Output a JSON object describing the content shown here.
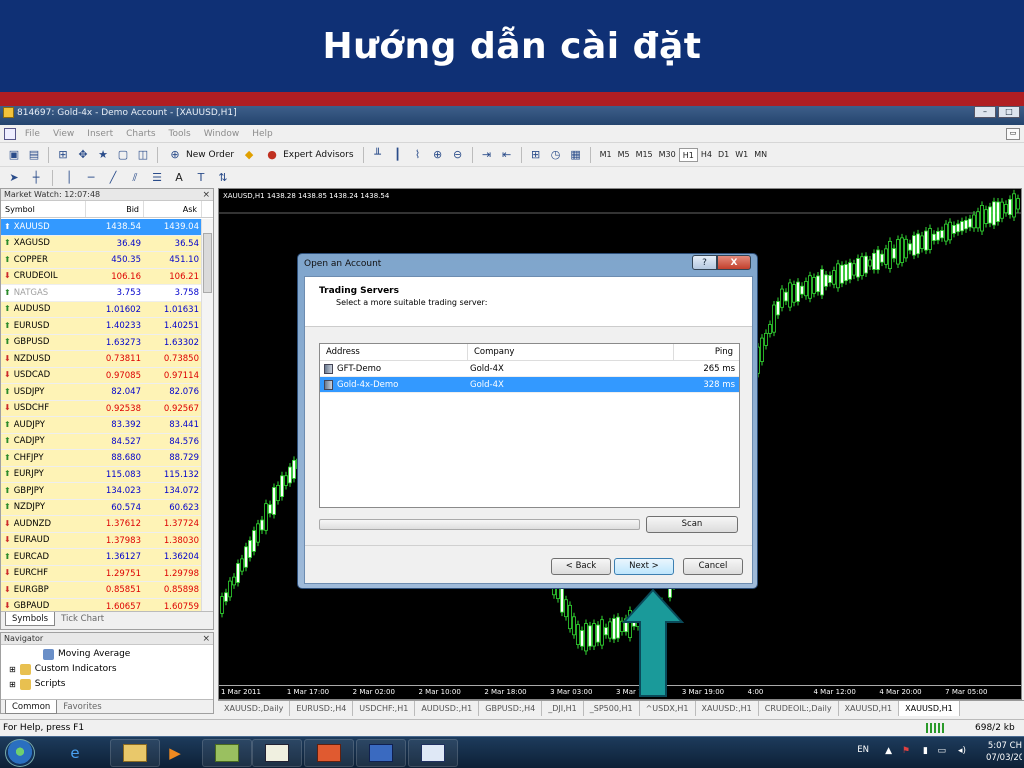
{
  "slide": {
    "title": "Hướng dẫn cài đặt"
  },
  "window": {
    "title": "814697: Gold-4x - Demo Account - [XAUUSD,H1]",
    "menu": [
      "File",
      "View",
      "Insert",
      "Charts",
      "Tools",
      "Window",
      "Help"
    ]
  },
  "toolbar": {
    "new_order": "New Order",
    "expert_advisors": "Expert Advisors",
    "timeframes": [
      "M1",
      "M5",
      "M15",
      "M30",
      "H1",
      "H4",
      "D1",
      "W1",
      "MN"
    ],
    "active_timeframe": "H1",
    "text_tool": "A"
  },
  "market_watch": {
    "title": "Market Watch: 12:07:48",
    "headers": {
      "symbol": "Symbol",
      "bid": "Bid",
      "ask": "Ask"
    },
    "rows": [
      {
        "symbol": "XAUUSD",
        "bid": "1438.54",
        "ask": "1439.04",
        "dir": "up",
        "style": "sel",
        "color": "#ffffff"
      },
      {
        "symbol": "XAGUSD",
        "bid": "36.49",
        "ask": "36.54",
        "dir": "up",
        "style": "yellow",
        "color": "#0000cc"
      },
      {
        "symbol": "COPPER",
        "bid": "450.35",
        "ask": "451.10",
        "dir": "up",
        "style": "yellow",
        "color": "#0000cc"
      },
      {
        "symbol": "CRUDEOIL",
        "bid": "106.16",
        "ask": "106.21",
        "dir": "down",
        "style": "yellow",
        "color": "#dd0000"
      },
      {
        "symbol": "NATGAS",
        "bid": "3.753",
        "ask": "3.758",
        "dir": "up",
        "style": "dim",
        "color": "#0000cc"
      },
      {
        "symbol": "AUDUSD",
        "bid": "1.01602",
        "ask": "1.01631",
        "dir": "up",
        "style": "yellow",
        "color": "#0000cc"
      },
      {
        "symbol": "EURUSD",
        "bid": "1.40233",
        "ask": "1.40251",
        "dir": "up",
        "style": "yellow",
        "color": "#0000cc"
      },
      {
        "symbol": "GBPUSD",
        "bid": "1.63273",
        "ask": "1.63302",
        "dir": "up",
        "style": "yellow",
        "color": "#0000cc"
      },
      {
        "symbol": "NZDUSD",
        "bid": "0.73811",
        "ask": "0.73850",
        "dir": "down",
        "style": "yellow",
        "color": "#dd0000"
      },
      {
        "symbol": "USDCAD",
        "bid": "0.97085",
        "ask": "0.97114",
        "dir": "down",
        "style": "yellow",
        "color": "#dd0000"
      },
      {
        "symbol": "USDJPY",
        "bid": "82.047",
        "ask": "82.076",
        "dir": "up",
        "style": "yellow",
        "color": "#0000cc"
      },
      {
        "symbol": "USDCHF",
        "bid": "0.92538",
        "ask": "0.92567",
        "dir": "down",
        "style": "yellow",
        "color": "#dd0000"
      },
      {
        "symbol": "AUDJPY",
        "bid": "83.392",
        "ask": "83.441",
        "dir": "up",
        "style": "yellow",
        "color": "#0000cc"
      },
      {
        "symbol": "CADJPY",
        "bid": "84.527",
        "ask": "84.576",
        "dir": "up",
        "style": "yellow",
        "color": "#0000cc"
      },
      {
        "symbol": "CHFJPY",
        "bid": "88.680",
        "ask": "88.729",
        "dir": "up",
        "style": "yellow",
        "color": "#0000cc"
      },
      {
        "symbol": "EURJPY",
        "bid": "115.083",
        "ask": "115.132",
        "dir": "up",
        "style": "yellow",
        "color": "#0000cc"
      },
      {
        "symbol": "GBPJPY",
        "bid": "134.023",
        "ask": "134.072",
        "dir": "up",
        "style": "yellow",
        "color": "#0000cc"
      },
      {
        "symbol": "NZDJPY",
        "bid": "60.574",
        "ask": "60.623",
        "dir": "up",
        "style": "yellow",
        "color": "#0000cc"
      },
      {
        "symbol": "AUDNZD",
        "bid": "1.37612",
        "ask": "1.37724",
        "dir": "down",
        "style": "yellow",
        "color": "#dd0000"
      },
      {
        "symbol": "EURAUD",
        "bid": "1.37983",
        "ask": "1.38030",
        "dir": "down",
        "style": "yellow",
        "color": "#dd0000"
      },
      {
        "symbol": "EURCAD",
        "bid": "1.36127",
        "ask": "1.36204",
        "dir": "up",
        "style": "yellow",
        "color": "#0000cc"
      },
      {
        "symbol": "EURCHF",
        "bid": "1.29751",
        "ask": "1.29798",
        "dir": "down",
        "style": "yellow",
        "color": "#dd0000"
      },
      {
        "symbol": "EURGBP",
        "bid": "0.85851",
        "ask": "0.85898",
        "dir": "down",
        "style": "yellow",
        "color": "#dd0000"
      },
      {
        "symbol": "GBPAUD",
        "bid": "1.60657",
        "ask": "1.60759",
        "dir": "down",
        "style": "yellow",
        "color": "#dd0000"
      }
    ],
    "tabs": [
      "Symbols",
      "Tick Chart"
    ]
  },
  "navigator": {
    "title": "Navigator",
    "items": [
      "Moving Average",
      "Custom Indicators",
      "Scripts"
    ],
    "tabs": [
      "Common",
      "Favorites"
    ]
  },
  "chart": {
    "label": "XAUUSD,H1  1438.28 1438.85 1438.24 1438.54",
    "time_labels": [
      "1 Mar 2011",
      "1 Mar 17:00",
      "2 Mar 02:00",
      "2 Mar 10:00",
      "2 Mar 18:00",
      "3 Mar 03:00",
      "3 Mar 11:00",
      "3 Mar 19:00",
      "4:00",
      "4 Mar 12:00",
      "4 Mar 20:00",
      "7 Mar 05:00"
    ],
    "tabs": [
      "XAUUSD:,Daily",
      "EURUSD:,H4",
      "USDCHF:,H1",
      "AUDUSD:,H1",
      "GBPUSD:,H4",
      "_DJI,H1",
      "_SP500,H1",
      "^USDX,H1",
      "XAUUSD:,H1",
      "CRUDEOIL:,Daily",
      "XAUUSD,H1",
      "XAUUSD,H1"
    ],
    "active_tab": 11
  },
  "status": {
    "help": "For Help, press F1",
    "traffic": "698/2 kb"
  },
  "dialog": {
    "title": "Open an Account",
    "help_btn": "?",
    "close_btn": "X",
    "heading": "Trading Servers",
    "subheading": "Select a more suitable trading server:",
    "columns": {
      "address": "Address",
      "company": "Company",
      "ping": "Ping"
    },
    "servers": [
      {
        "address": "GFT-Demo",
        "company": "Gold-4X",
        "ping": "265 ms",
        "selected": false
      },
      {
        "address": "Gold-4x-Demo",
        "company": "Gold-4X",
        "ping": "328 ms",
        "selected": true
      }
    ],
    "scan": "Scan",
    "back": "< Back",
    "next": "Next >",
    "cancel": "Cancel"
  },
  "taskbar": {
    "lang": "EN",
    "time": "5:07 CH",
    "date": "07/03/20"
  },
  "colors": {
    "slide_blue": "#0f3075",
    "slide_red": "#b01e22",
    "arrow": "#1a9a9a",
    "selection": "#3399ff"
  }
}
